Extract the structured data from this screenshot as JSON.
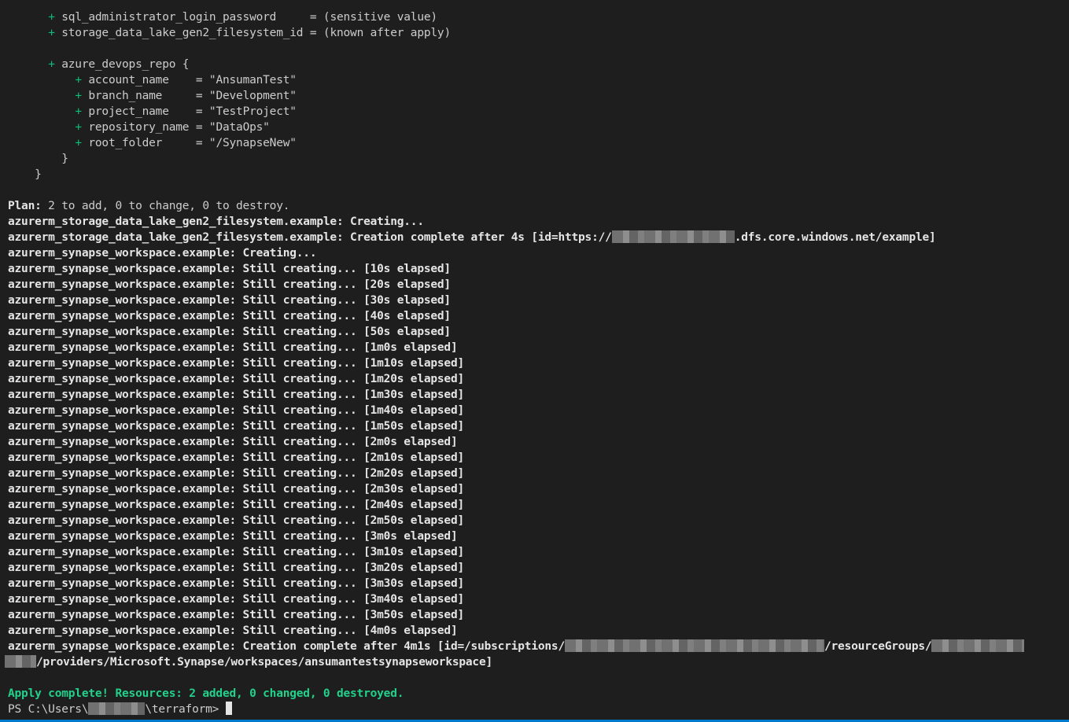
{
  "plan_attrs": [
    {
      "indent": "      ",
      "key": "sql_administrator_login_password    ",
      "value": " = (sensitive value)"
    },
    {
      "indent": "      ",
      "key": "storage_data_lake_gen2_filesystem_id",
      "value": " = (known after apply)"
    }
  ],
  "repo_block": {
    "header": "azure_devops_repo {",
    "attrs": [
      {
        "key": "account_name   ",
        "value": " = \"AnsumanTest\""
      },
      {
        "key": "branch_name    ",
        "value": " = \"Development\""
      },
      {
        "key": "project_name   ",
        "value": " = \"TestProject\""
      },
      {
        "key": "repository_name",
        "value": " = \"DataOps\""
      },
      {
        "key": "root_folder    ",
        "value": " = \"/SynapseNew\""
      }
    ],
    "close_inner": "        }",
    "close_outer": "    }"
  },
  "plus_sign": "+",
  "plan_summary": {
    "label": "Plan:",
    "text": " 2 to add, 0 to change, 0 to destroy."
  },
  "storage": {
    "creating": "azurerm_storage_data_lake_gen2_filesystem.example: Creating...",
    "complete_prefix": "azurerm_storage_data_lake_gen2_filesystem.example: Creation complete after 4s [id=https://",
    "complete_suffix": ".dfs.core.windows.net/example]"
  },
  "synapse": {
    "creating": "azurerm_synapse_workspace.example: Creating...",
    "still_prefix": "azurerm_synapse_workspace.example: Still creating... ",
    "elapsed": [
      "[10s elapsed]",
      "[20s elapsed]",
      "[30s elapsed]",
      "[40s elapsed]",
      "[50s elapsed]",
      "[1m0s elapsed]",
      "[1m10s elapsed]",
      "[1m20s elapsed]",
      "[1m30s elapsed]",
      "[1m40s elapsed]",
      "[1m50s elapsed]",
      "[2m0s elapsed]",
      "[2m10s elapsed]",
      "[2m20s elapsed]",
      "[2m30s elapsed]",
      "[2m40s elapsed]",
      "[2m50s elapsed]",
      "[3m0s elapsed]",
      "[3m10s elapsed]",
      "[3m20s elapsed]",
      "[3m30s elapsed]",
      "[3m40s elapsed]",
      "[3m50s elapsed]",
      "[4m0s elapsed]"
    ],
    "complete_prefix": "azurerm_synapse_workspace.example: Creation complete after 4m1s [id=/subscriptions/",
    "complete_mid": "/resourceGroups/",
    "complete_cont": "/providers/Microsoft.Synapse/workspaces/ansumantestsynapseworkspace]"
  },
  "apply_complete": "Apply complete! Resources: 2 added, 0 changed, 0 destroyed.",
  "prompt": {
    "prefix": "PS C:\\Users\\",
    "suffix": "\\terraform> "
  },
  "colors": {
    "background": "#1e1e1e",
    "text": "#cccccc",
    "plus": "#0dbc79",
    "success": "#23d18b",
    "statusbar": "#007acc"
  }
}
